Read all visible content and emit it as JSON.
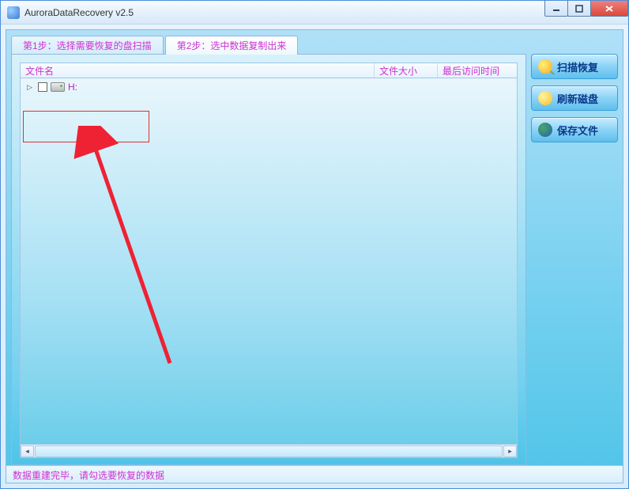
{
  "window": {
    "title": "AuroraDataRecovery v2.5"
  },
  "tabs": [
    {
      "label": "第1步：选择需要恢复的盘扫描"
    },
    {
      "label": "第2步：选中数据复制出来"
    }
  ],
  "columns": {
    "name": "文件名",
    "size": "文件大小",
    "time": "最后访问时间"
  },
  "tree": {
    "items": [
      {
        "label": "H:"
      }
    ]
  },
  "side_buttons": {
    "scan": "扫描恢复",
    "refresh": "刷新磁盘",
    "save": "保存文件"
  },
  "status": "数据重建完毕，请勾选要恢复的数据"
}
